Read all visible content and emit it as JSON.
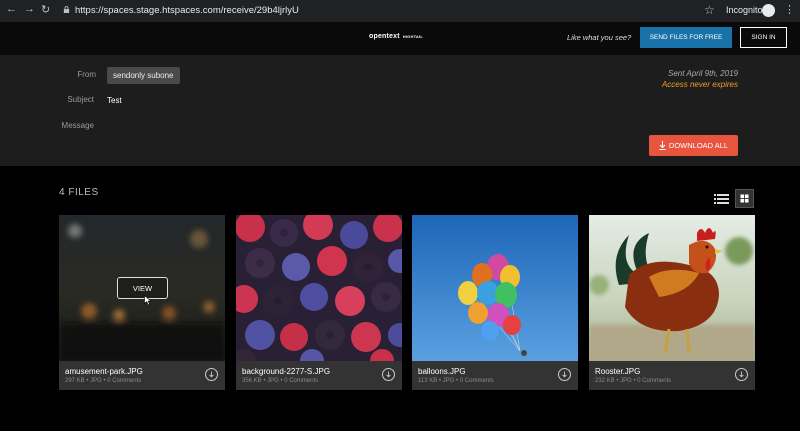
{
  "browser": {
    "url": "https://spaces.stage.htspaces.com/receive/29b4ljrlyU",
    "mode_label": "Incognito"
  },
  "header": {
    "logo": "opentext",
    "logo_sub": "HIGHTAIL",
    "like_text": "Like what you see?",
    "send_button": "SEND FILES FOR FREE",
    "signin_button": "SIGN IN"
  },
  "message": {
    "from_label": "From",
    "from_value": "sendonly subone",
    "subject_label": "Subject",
    "subject_value": "Test",
    "message_label": "Message",
    "sent": "Sent April 9th, 2019",
    "expires": "Access never expires",
    "download_all": "DOWNLOAD ALL"
  },
  "files": {
    "count_label": "4 FILES",
    "items": [
      {
        "name": "amusement-park.JPG",
        "meta": "297 KB  •  JPG  •  0 Comments",
        "hover_label": "VIEW"
      },
      {
        "name": "background-2277-S.JPG",
        "meta": "356 KB  •  JPG  •  0 Comments"
      },
      {
        "name": "balloons.JPG",
        "meta": "113 KB  •  JPG  •  0 Comments"
      },
      {
        "name": "Rooster.JPG",
        "meta": "232 KB  •  JPG  •  0 Comments"
      }
    ]
  },
  "colors": {
    "accent_blue": "#1a73a8",
    "download_red": "#e8553e",
    "expires_orange": "#f0a020"
  }
}
